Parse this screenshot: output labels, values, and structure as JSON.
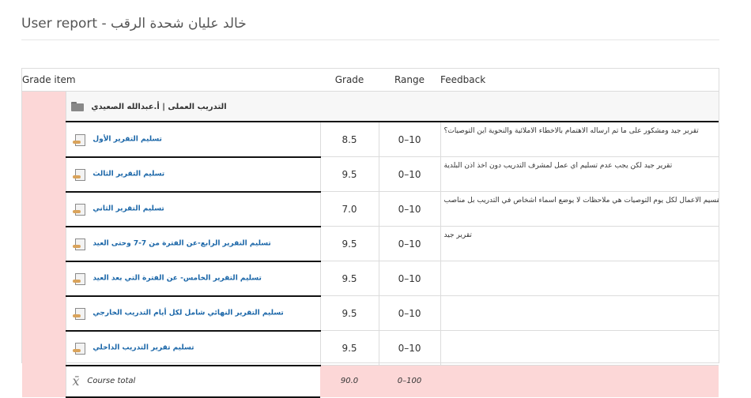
{
  "page": {
    "title": "User report - خالد عليان شحدة الرقب"
  },
  "table": {
    "headers": {
      "item": "Grade item",
      "grade": "Grade",
      "range": "Range",
      "feedback": "Feedback"
    },
    "category": {
      "label": "التدريب العملى | أ.عبدالله الصعيدي",
      "icon": "folder-icon"
    },
    "items": [
      {
        "name": "تسليم التقرير الأول",
        "grade": "8.5",
        "range": "0–10",
        "feedback": "تقرير جيد ومشكور على ما تم ارساله الاهتمام بالاخطاء الاملائية والنحوية اين التوصيات؟"
      },
      {
        "name": "تسليم التقرير الثالث",
        "grade": "9.5",
        "range": "0–10",
        "feedback": "تقرير جيد لكن يجب عدم تسليم اي عمل لمشرف التدريب دون اخذ اذن البلدية"
      },
      {
        "name": "تسليم التقرير الثاني",
        "grade": "7.0",
        "range": "0–10",
        "feedback": "يجب تقسيم الاعمال لكل يوم التوصيات هي ملاحظات لا يوضع اسماء اشخاص في التدريب بل مناصب"
      },
      {
        "name": "تسليم التقرير الرابع-عن الفترة من 7-7 وحتى العيد",
        "grade": "9.5",
        "range": "0–10",
        "feedback": "تقرير جيد"
      },
      {
        "name": "تسليم التقرير الخامس- عن الفترة التي بعد العيد",
        "grade": "9.5",
        "range": "0–10",
        "feedback": ""
      },
      {
        "name": "تسليم التقرير النهائي شامل لكل أيام التدريب الخارجي",
        "grade": "9.5",
        "range": "0–10",
        "feedback": ""
      },
      {
        "name": "تسليم تقرير التدريب الداخلي",
        "grade": "9.5",
        "range": "0–10",
        "feedback": ""
      }
    ],
    "total": {
      "label": "Course total",
      "grade": "90.0",
      "range": "0–100"
    }
  },
  "colors": {
    "highlight": "#fcd7d7",
    "link": "#1a66a8"
  }
}
